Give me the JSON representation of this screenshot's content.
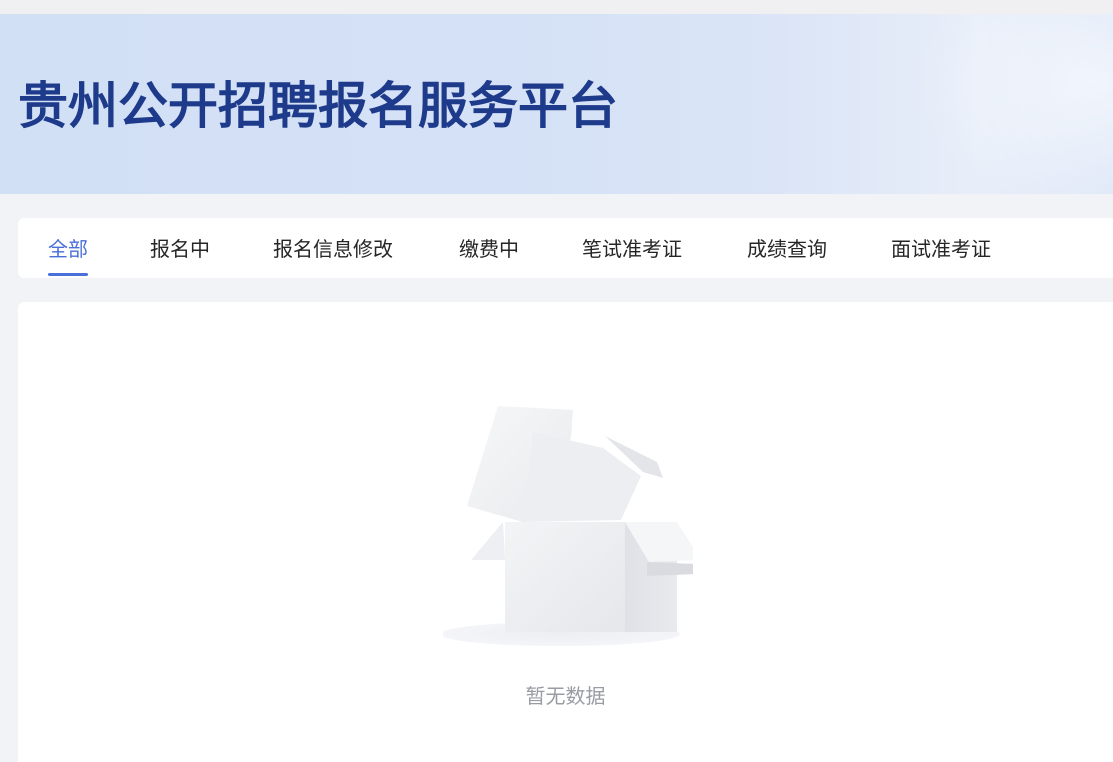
{
  "banner": {
    "title": "贵州公开招聘报名服务平台"
  },
  "tabs": [
    {
      "label": "全部",
      "active": true
    },
    {
      "label": "报名中",
      "active": false
    },
    {
      "label": "报名信息修改",
      "active": false
    },
    {
      "label": "缴费中",
      "active": false
    },
    {
      "label": "笔试准考证",
      "active": false
    },
    {
      "label": "成绩查询",
      "active": false
    },
    {
      "label": "面试准考证",
      "active": false
    }
  ],
  "empty_state": {
    "icon": "empty-box-icon",
    "text": "暂无数据"
  },
  "colors": {
    "title": "#1e3a8a",
    "accent": "#4a6fd8",
    "page_background": "#f2f3f7",
    "banner_background": "#d2e0f6",
    "empty_text": "#9a9ca3"
  }
}
